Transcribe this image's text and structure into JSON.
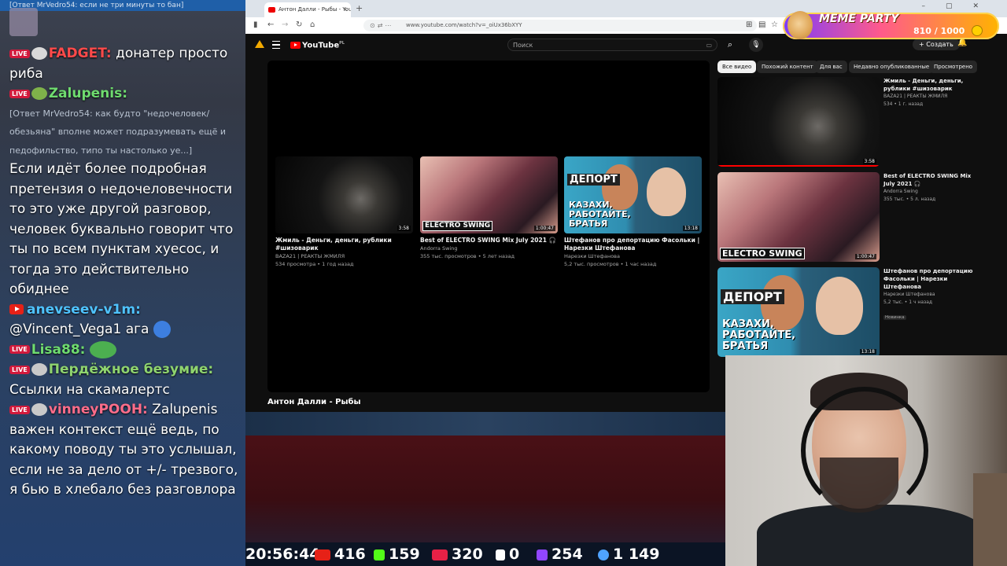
{
  "chat": {
    "top_reply": "[Ответ MrVedro54: если не три минуты то бан]",
    "messages": [
      {
        "user": "FADGET:",
        "user_color": "#ff4a4a",
        "text": "донатер просто риба"
      },
      {
        "user": "Zalupenis:",
        "user_color": "#6fdc6f",
        "text": ""
      },
      {
        "reply": "[Ответ MrVedro54: как будто \"недочеловек/обезьяна\" вполне может подразумевать ещё и педофильство, типо ты настолько уе...]"
      },
      {
        "text": "Если идёт более подробная претензия о недочеловечности то это уже другой разговор, человек буквально говорит что ты по всем пунктам хуесос, и тогда это действительно обиднее"
      },
      {
        "user": "anevseev-v1m:",
        "user_color": "#4fc3ff",
        "text": ""
      },
      {
        "text": "@Vincent_Vega1 ага"
      },
      {
        "user": "Lisa88:",
        "user_color": "#6fdc6f",
        "text": ""
      },
      {
        "user": "Пердёжное безумие:",
        "user_color": "#8fd46f",
        "text": ""
      },
      {
        "text": "Ссылки на скамалертс"
      },
      {
        "user": "vinneyPOOH:",
        "user_color": "#ff6d8a",
        "text": "Zalupenis важен контекст ещё ведь, по какому поводу ты это услышал, если не за дело от +/- трезвого, я бью в хлебало без разговлора"
      }
    ],
    "live_badge": "LIVE"
  },
  "browser": {
    "tab_title": "Антон Далли - Рыбы - YouTube",
    "tab_close": "×",
    "new_tab": "+",
    "url": "www.youtube.com/watch?v=_oiUx36bXYY",
    "nav_back": "←",
    "nav_forward": "→",
    "nav_reload": "↻",
    "nav_home": "⌂"
  },
  "youtube": {
    "logo": "YouTube",
    "logo_region": "PL",
    "search_placeholder": "Поиск",
    "create_label": "+ Создать",
    "now_playing_title": "Антон Далли - Рыбы",
    "player_endscreen": [
      {
        "title": "Жмиль - Деньги, деньги, рублики #шизоварик",
        "channel": "BAZA21 | РЕАКТЫ ЖМИЛЯ",
        "meta": "534 просмотра • 1 год назад",
        "duration": "3:58"
      },
      {
        "title": "Best of ELECTRO SWING Mix July 2021 🎧",
        "channel": "Andorra Swing",
        "meta": "355 тыс. просмотров • 5 лет назад",
        "duration": "1:00:47"
      },
      {
        "title": "Штефанов про депортацию Фасольки | Нарезки Штефанова",
        "channel": "Нарезки Штефанова",
        "meta": "5,2 тыс. просмотров • 1 час назад",
        "duration": "13:18"
      }
    ],
    "chips": [
      "Все видео",
      "Похожий контент",
      "Для вас",
      "Недавно опубликованные",
      "Просмотрено"
    ],
    "sidebar": [
      {
        "title": "Жмиль - Деньги, деньги, рублики #шизоварик",
        "channel": "BAZA21 | РЕАКТЫ ЖМИЛЯ",
        "meta": "534 • 1 г. назад",
        "duration": "3:58"
      },
      {
        "title": "Best of ELECTRO SWING Mix July 2021 🎧",
        "channel": "Andorra Swing",
        "meta": "355 тыс. • 5 л. назад",
        "duration": "1:00:47"
      },
      {
        "title": "Штефанов про депортацию Фасольки | Нарезки Штефанова",
        "channel": "Нарезки Штефанова",
        "meta": "5,2 тыс. • 1 ч назад",
        "duration": "13:18",
        "badge": "Новинка"
      }
    ],
    "electro_swing_label": "ELECTRO SWING",
    "deport_label": "ДЕПОРТ",
    "kazakh_label": "КАЗАХИ, РАБОТАЙТЕ, БРАТЬЯ"
  },
  "meme_party": {
    "title": "MEME PARTY",
    "counter": "810 / 1000"
  },
  "stats": {
    "time": "20:56:44",
    "youtube_viewers": "416",
    "kick_viewers": "159",
    "vk_viewers": "320",
    "rutube_viewers": "0",
    "twitch_viewers": "254",
    "total_viewers": "1 149"
  }
}
